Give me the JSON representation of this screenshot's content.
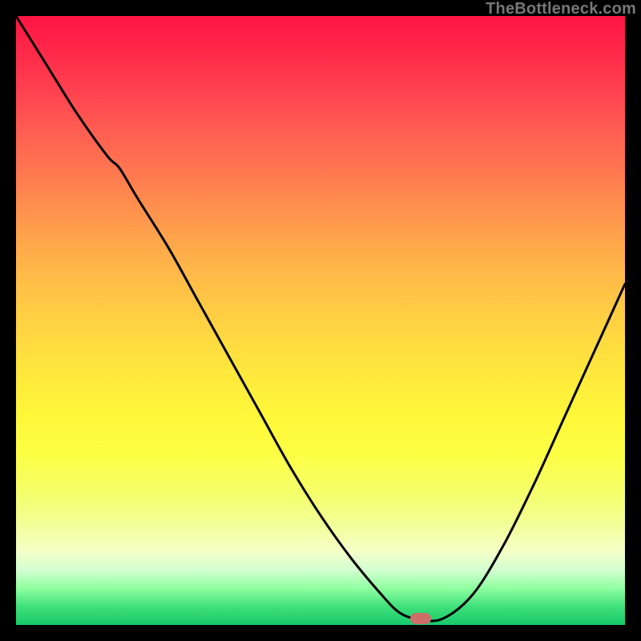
{
  "watermark": "TheBottleneck.com",
  "colors": {
    "background": "#000000",
    "curve_stroke": "#000000",
    "marker_fill": "#cd6e69"
  },
  "marker": {
    "x_frac": 0.665,
    "y_frac": 0.99
  },
  "chart_data": {
    "type": "line",
    "title": "",
    "xlabel": "",
    "ylabel": "",
    "xlim": [
      0,
      100
    ],
    "ylim": [
      0,
      100
    ],
    "series": [
      {
        "name": "bottleneck-curve",
        "x": [
          0,
          5,
          10,
          15,
          17,
          20,
          25,
          30,
          35,
          40,
          45,
          50,
          55,
          60,
          63,
          66,
          70,
          75,
          80,
          85,
          90,
          95,
          100
        ],
        "y": [
          100,
          92,
          84,
          77,
          75,
          70,
          62,
          53,
          44,
          35,
          26,
          18,
          11,
          5,
          2,
          1,
          1,
          5,
          13,
          23,
          34,
          45,
          56
        ]
      }
    ],
    "annotations": [
      {
        "type": "marker",
        "shape": "pill",
        "x": 66.5,
        "y": 1
      }
    ],
    "legend": false,
    "grid": false
  }
}
